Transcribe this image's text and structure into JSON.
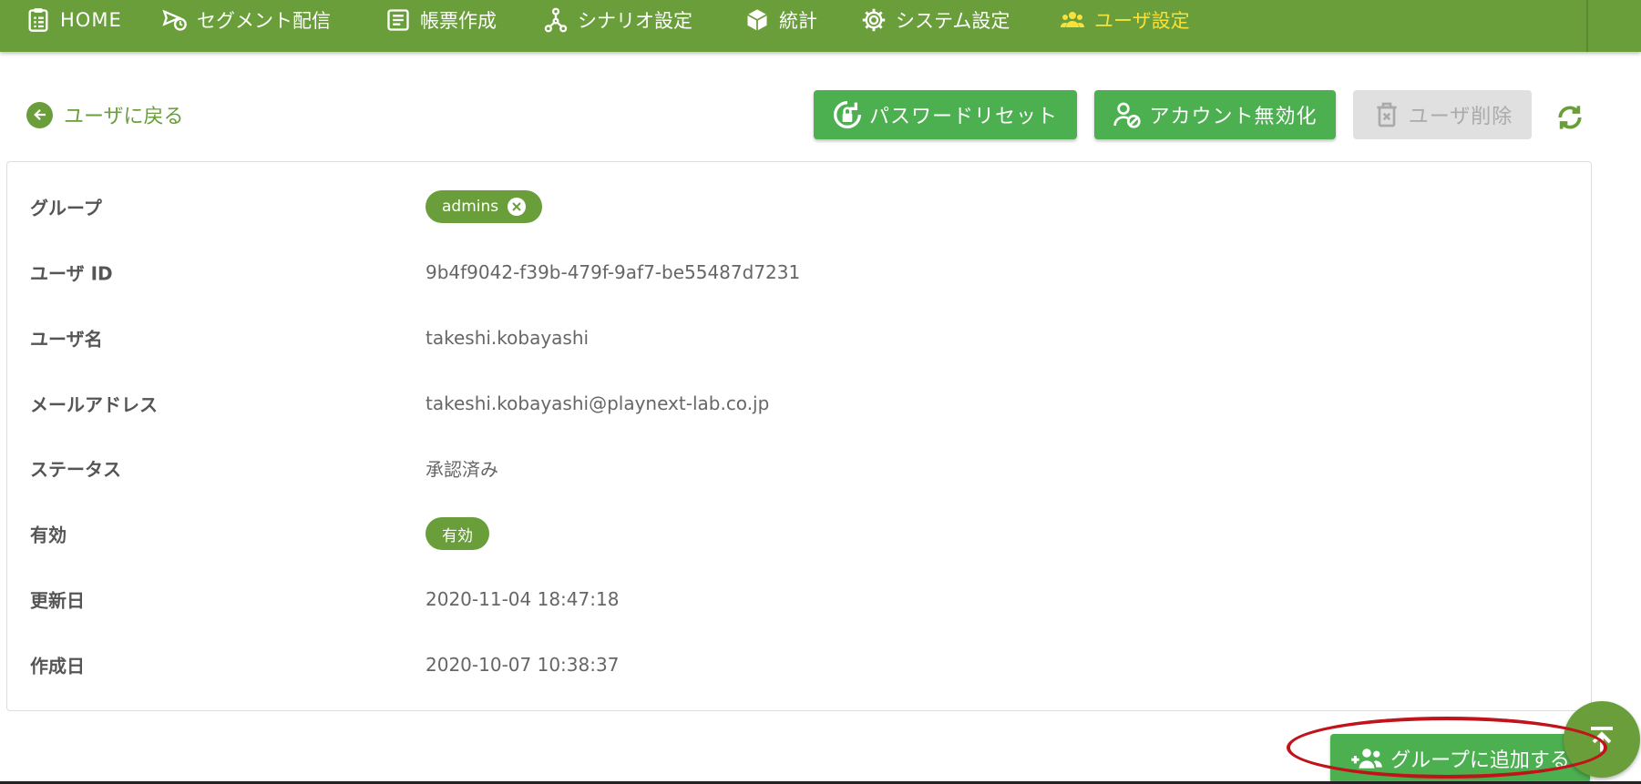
{
  "nav": {
    "items": [
      {
        "label": "HOME",
        "icon": "clipboard-list-icon"
      },
      {
        "label": "セグメント配信",
        "icon": "send-clock-icon"
      },
      {
        "label": "帳票作成",
        "icon": "document-list-icon"
      },
      {
        "label": "シナリオ設定",
        "icon": "graph-nodes-icon"
      },
      {
        "label": "統計",
        "icon": "cube-icon"
      },
      {
        "label": "システム設定",
        "icon": "gear-icon"
      },
      {
        "label": "ユーザ設定",
        "icon": "users-icon",
        "active": true
      }
    ]
  },
  "actions": {
    "back_label": "ユーザに戻る",
    "password_reset": "パスワードリセット",
    "disable_account": "アカウント無効化",
    "delete_user": "ユーザ削除"
  },
  "details": {
    "group_label": "グループ",
    "group_chip": "admins",
    "user_id_label": "ユーザ ID",
    "user_id": "9b4f9042-f39b-479f-9af7-be55487d7231",
    "username_label": "ユーザ名",
    "username": "takeshi.kobayashi",
    "email_label": "メールアドレス",
    "email": "takeshi.kobayashi@playnext-lab.co.jp",
    "status_label": "ステータス",
    "status": "承認済み",
    "enabled_label": "有効",
    "enabled_chip": "有効",
    "updated_label": "更新日",
    "updated": "2020-11-04 18:47:18",
    "created_label": "作成日",
    "created": "2020-10-07 10:38:37"
  },
  "bottom": {
    "add_group": "グループに追加する"
  },
  "colors": {
    "nav_bg": "#6a9e3a",
    "nav_active": "#f6e23a",
    "button_green": "#4caf50",
    "chip_green": "#6a9e3a",
    "highlight_red": "#c0131a"
  }
}
